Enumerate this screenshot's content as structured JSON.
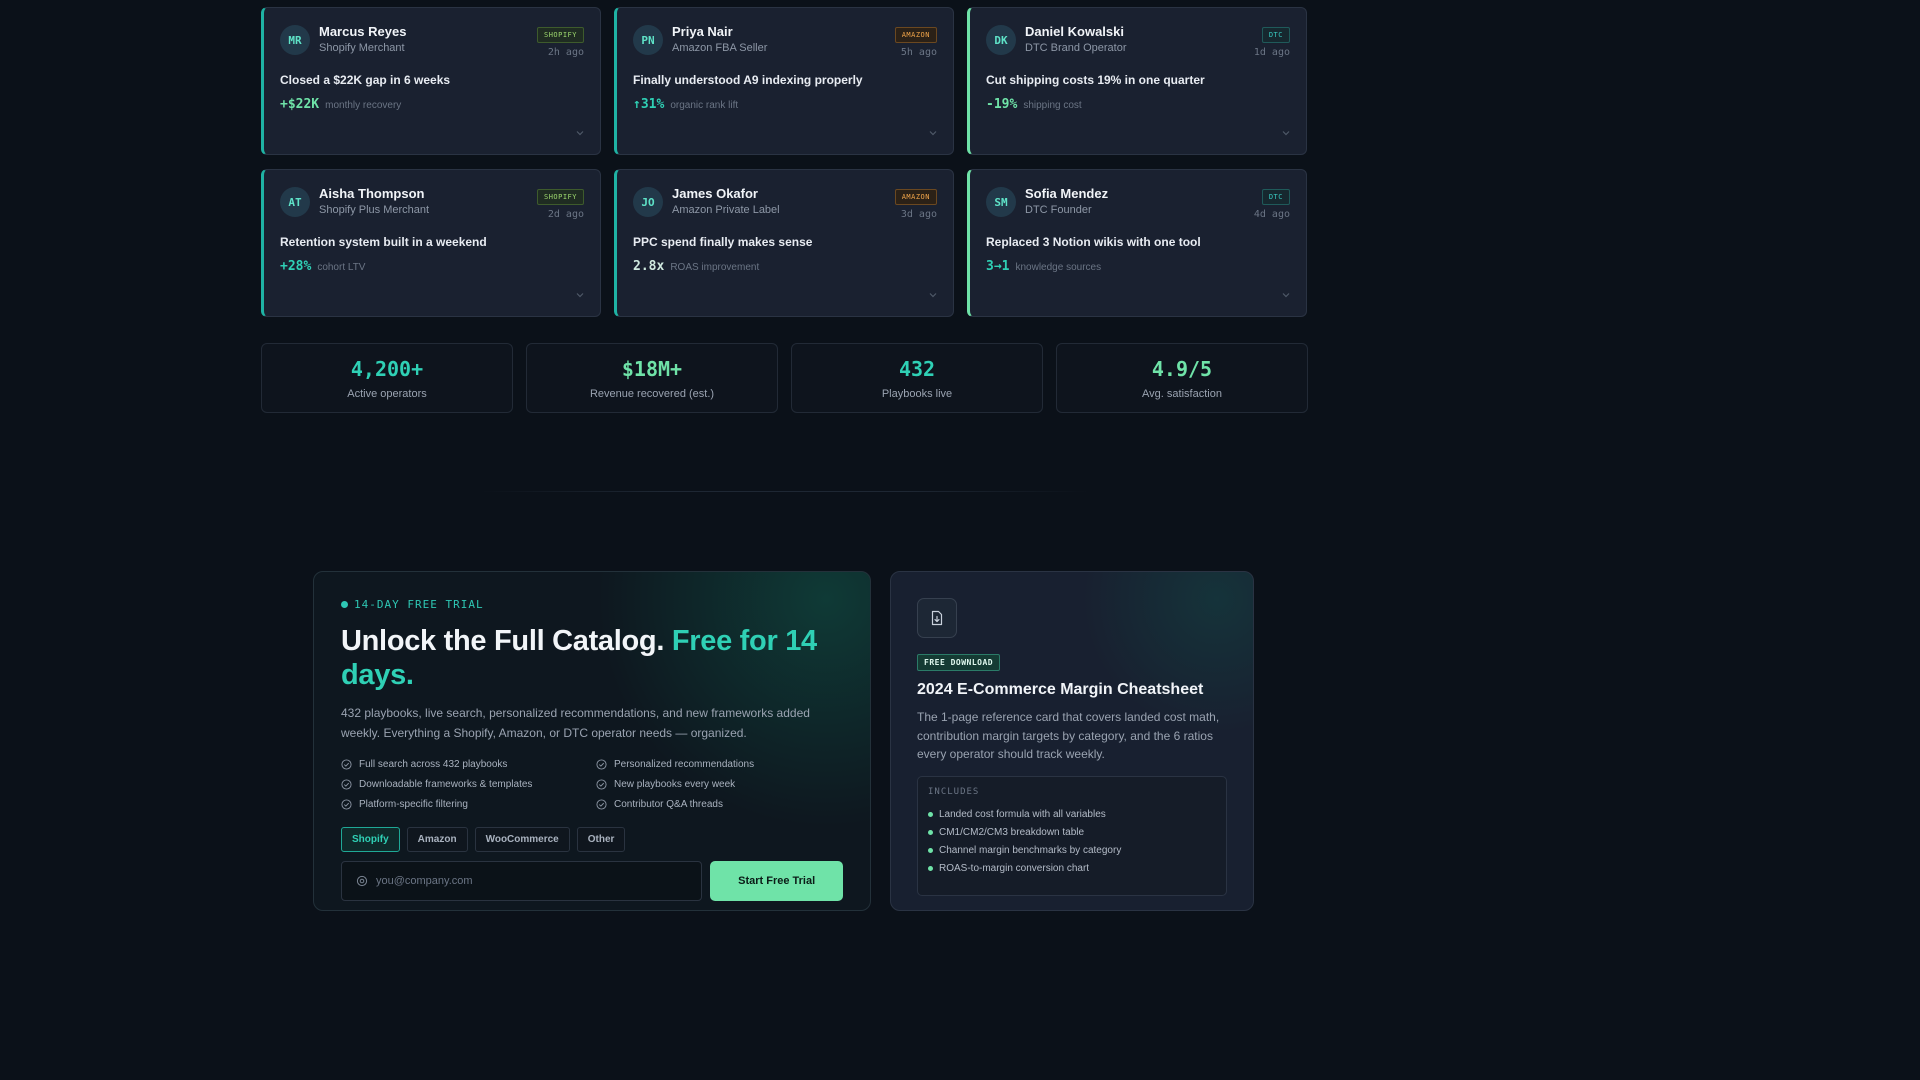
{
  "testimonials": [
    {
      "initials": "MR",
      "name": "Marcus Reyes",
      "role": "Shopify Merchant",
      "badge": "SHOPIFY",
      "platform": "shopify",
      "ago": "2h ago",
      "headline": "Closed a $22K gap in 6 weeks",
      "metric": "+$22K",
      "metric_label": "monthly recovery",
      "metric_color": "#6fe3a8"
    },
    {
      "initials": "PN",
      "name": "Priya Nair",
      "role": "Amazon FBA Seller",
      "badge": "AMAZON",
      "platform": "amazon",
      "ago": "5h ago",
      "headline": "Finally understood A9 indexing properly",
      "metric": "↑31%",
      "metric_label": "organic rank lift",
      "metric_color": "#2fd0b5"
    },
    {
      "initials": "DK",
      "name": "Daniel Kowalski",
      "role": "DTC Brand Operator",
      "badge": "DTC",
      "platform": "dtc",
      "ago": "1d ago",
      "headline": "Cut shipping costs 19% in one quarter",
      "metric": "-19%",
      "metric_label": "shipping cost",
      "metric_color": "#6fe3a8"
    },
    {
      "initials": "AT",
      "name": "Aisha Thompson",
      "role": "Shopify Plus Merchant",
      "badge": "SHOPIFY",
      "platform": "shopify",
      "ago": "2d ago",
      "headline": "Retention system built in a weekend",
      "metric": "+28%",
      "metric_label": "cohort LTV",
      "metric_color": "#2fd0b5"
    },
    {
      "initials": "JO",
      "name": "James Okafor",
      "role": "Amazon Private Label",
      "badge": "AMAZON",
      "platform": "amazon",
      "ago": "3d ago",
      "headline": "PPC spend finally makes sense",
      "metric": "2.8x",
      "metric_label": "ROAS improvement",
      "metric_color": "#cfe9df"
    },
    {
      "initials": "SM",
      "name": "Sofia Mendez",
      "role": "DTC Founder",
      "badge": "DTC",
      "platform": "dtc",
      "ago": "4d ago",
      "headline": "Replaced 3 Notion wikis with one tool",
      "metric": "3→1",
      "metric_label": "knowledge sources",
      "metric_color": "#2fd0b5"
    }
  ],
  "stats": [
    {
      "value": "4,200+",
      "label": "Active operators",
      "color": "#2fd0b5"
    },
    {
      "value": "$18M+",
      "label": "Revenue recovered (est.)",
      "color": "#6fe3a8"
    },
    {
      "value": "432",
      "label": "Playbooks live",
      "color": "#2fd0b5"
    },
    {
      "value": "4.9/5",
      "label": "Avg. satisfaction",
      "color": "#6fe3a8"
    }
  ],
  "trial": {
    "tag": "14-DAY FREE TRIAL",
    "title_main": "Unlock the Full Catalog. ",
    "title_highlight": "Free for 14 days.",
    "description": "432 playbooks, live search, personalized recommendations, and new frameworks added weekly. Everything a Shopify, Amazon, or DTC operator needs — organized.",
    "features": [
      "Full search across 432 playbooks",
      "Personalized recommendations",
      "Downloadable frameworks & templates",
      "New playbooks every week",
      "Platform-specific filtering",
      "Contributor Q&A threads"
    ],
    "platforms": [
      "Shopify",
      "Amazon",
      "WooCommerce",
      "Other"
    ],
    "active_platform": "Shopify",
    "email_placeholder": "you@company.com",
    "cta_label": "Start Free Trial"
  },
  "download": {
    "badge": "FREE DOWNLOAD",
    "title": "2024 E-Commerce Margin Cheatsheet",
    "description": "The 1-page reference card that covers landed cost math, contribution margin targets by category, and the 6 ratios every operator should track weekly.",
    "includes_label": "INCLUDES",
    "includes": [
      "Landed cost formula with all variables",
      "CM1/CM2/CM3 breakdown table",
      "Channel margin benchmarks by category",
      "ROAS-to-margin conversion chart"
    ]
  },
  "colors": {
    "accent_teal": "#2fd0b5",
    "accent_green": "#6fe3a8",
    "background": "#0b1119"
  },
  "icons": {
    "chevron": "chevron-down-icon",
    "check": "check-circle-icon",
    "mail": "mail-icon",
    "download": "file-download-icon"
  }
}
